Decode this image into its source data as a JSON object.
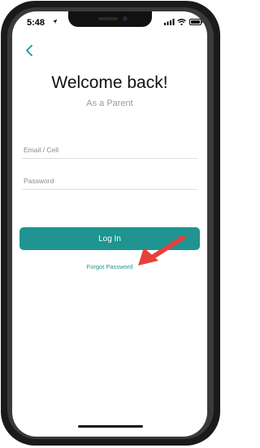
{
  "status_bar": {
    "time": "5:48"
  },
  "header": {
    "title": "Welcome back!",
    "subtitle": "As a Parent"
  },
  "form": {
    "email_placeholder": "Email / Cell",
    "email_value": "",
    "password_placeholder": "Password",
    "password_value": ""
  },
  "actions": {
    "login_label": "Log In",
    "forgot_label": "Forgot Password"
  },
  "colors": {
    "accent": "#1f9490",
    "annotation_arrow": "#e8403b"
  },
  "icons": [
    "location-arrow-icon",
    "signal-icon",
    "wifi-icon",
    "battery-icon",
    "back-chevron-icon"
  ]
}
